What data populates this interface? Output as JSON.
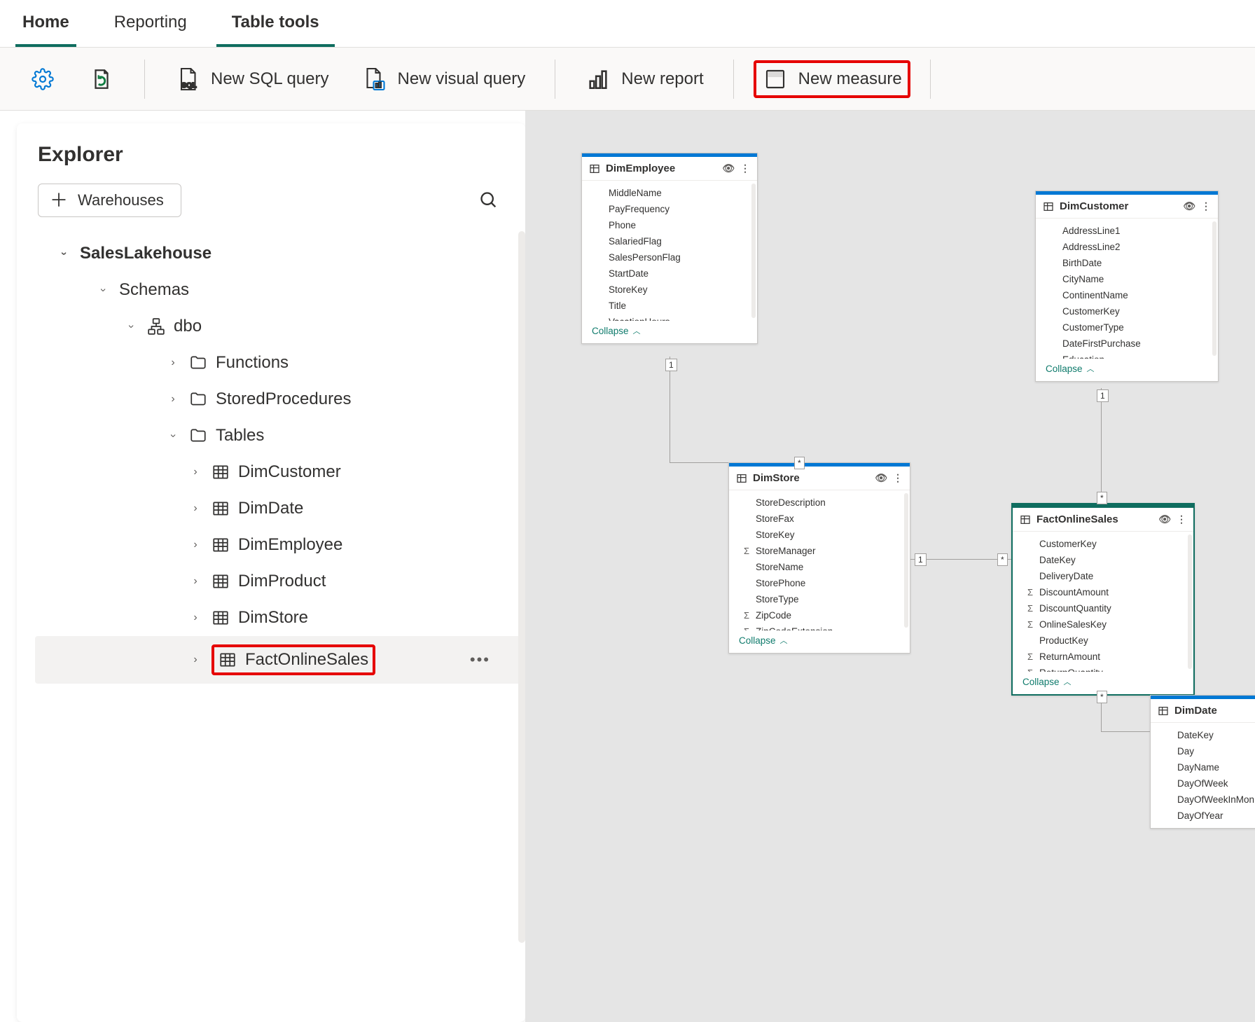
{
  "tabs": {
    "home": "Home",
    "reporting": "Reporting",
    "tabletools": "Table tools"
  },
  "toolbar": {
    "new_sql": "New SQL query",
    "new_visual": "New visual query",
    "new_report": "New report",
    "new_measure": "New measure"
  },
  "explorer": {
    "title": "Explorer",
    "warehouses_btn": "Warehouses",
    "root": "SalesLakehouse",
    "schemas": "Schemas",
    "dbo": "dbo",
    "functions": "Functions",
    "sprocs": "StoredProcedures",
    "tables": "Tables",
    "items": [
      "DimCustomer",
      "DimDate",
      "DimEmployee",
      "DimProduct",
      "DimStore",
      "FactOnlineSales"
    ]
  },
  "cards": {
    "dimemployee": {
      "title": "DimEmployee",
      "fields": [
        "MiddleName",
        "PayFrequency",
        "Phone",
        "SalariedFlag",
        "SalesPersonFlag",
        "StartDate",
        "StoreKey",
        "Title",
        "VacationHours"
      ],
      "collapse": "Collapse"
    },
    "dimcustomer": {
      "title": "DimCustomer",
      "fields": [
        "AddressLine1",
        "AddressLine2",
        "BirthDate",
        "CityName",
        "ContinentName",
        "CustomerKey",
        "CustomerType",
        "DateFirstPurchase",
        "Education"
      ],
      "collapse": "Collapse"
    },
    "dimstore": {
      "title": "DimStore",
      "fields": [
        {
          "n": "StoreDescription",
          "s": ""
        },
        {
          "n": "StoreFax",
          "s": ""
        },
        {
          "n": "StoreKey",
          "s": ""
        },
        {
          "n": "StoreManager",
          "s": "Σ"
        },
        {
          "n": "StoreName",
          "s": ""
        },
        {
          "n": "StorePhone",
          "s": ""
        },
        {
          "n": "StoreType",
          "s": ""
        },
        {
          "n": "ZipCode",
          "s": "Σ"
        },
        {
          "n": "ZipCodeExtension",
          "s": "Σ"
        }
      ],
      "collapse": "Collapse"
    },
    "factonlinesales": {
      "title": "FactOnlineSales",
      "fields": [
        {
          "n": "CustomerKey",
          "s": ""
        },
        {
          "n": "DateKey",
          "s": ""
        },
        {
          "n": "DeliveryDate",
          "s": ""
        },
        {
          "n": "DiscountAmount",
          "s": "Σ"
        },
        {
          "n": "DiscountQuantity",
          "s": "Σ"
        },
        {
          "n": "OnlineSalesKey",
          "s": "Σ"
        },
        {
          "n": "ProductKey",
          "s": ""
        },
        {
          "n": "ReturnAmount",
          "s": "Σ"
        },
        {
          "n": "ReturnQuantity",
          "s": "Σ"
        }
      ],
      "collapse": "Collapse"
    },
    "dimdate": {
      "title": "DimDate",
      "fields": [
        "DateKey",
        "Day",
        "DayName",
        "DayOfWeek",
        "DayOfWeekInMon",
        "DayOfYear"
      ]
    }
  },
  "icons": {
    "chevron_right": "›",
    "sigma": "Σ"
  }
}
